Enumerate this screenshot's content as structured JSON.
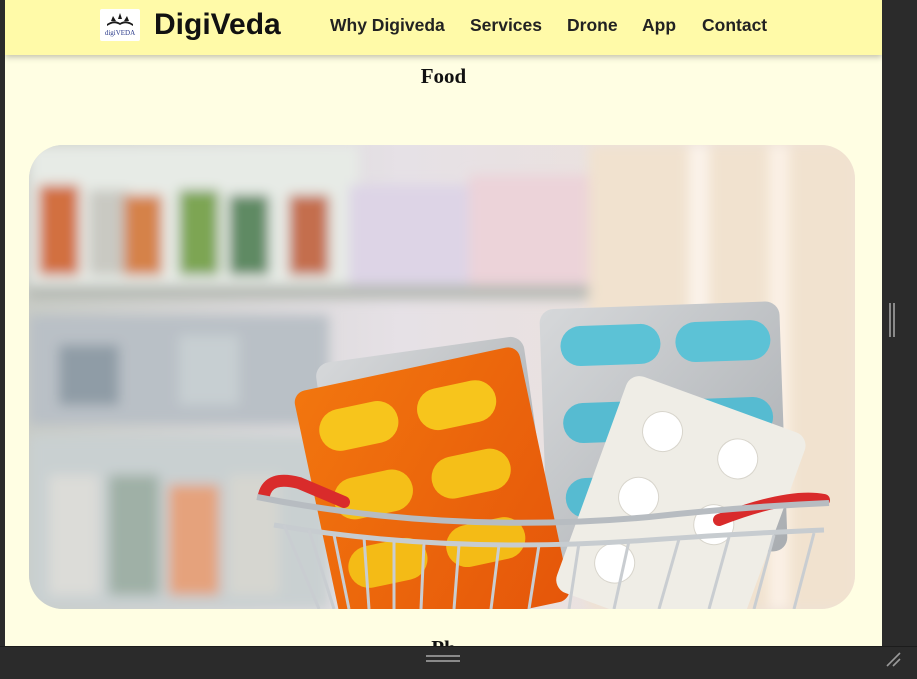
{
  "navbar": {
    "logo_text": "digiVEDA",
    "brand": "DigiVeda",
    "links": [
      {
        "label": "Why Digiveda"
      },
      {
        "label": "Services"
      },
      {
        "label": "Drone"
      },
      {
        "label": "App"
      },
      {
        "label": "Contact"
      }
    ]
  },
  "main": {
    "section_title": "Food",
    "next_section_title": "Ph",
    "hero_image": {
      "icon": "pharmacy-basket-image"
    }
  },
  "window": {
    "vertical_grip_icon": "vertical-resize-grip-icon",
    "horizontal_grip_icon": "horizontal-resize-grip-icon",
    "corner_icon": "resize-corner-icon"
  }
}
